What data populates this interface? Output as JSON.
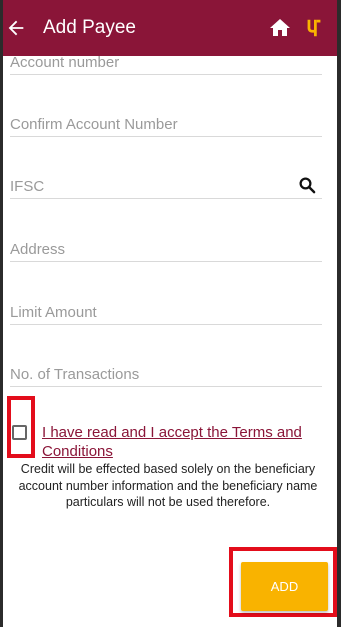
{
  "appbar": {
    "title": "Add Payee",
    "back_icon": "arrow-back-icon",
    "home_icon": "home-icon",
    "logo_icon": "bank-logo-icon",
    "background_color": "#8a1538"
  },
  "form": {
    "account_number": {
      "placeholder": "Account number"
    },
    "confirm_account_number": {
      "placeholder": "Confirm Account Number"
    },
    "ifsc": {
      "placeholder": "IFSC",
      "search_icon": "search-icon"
    },
    "address": {
      "placeholder": "Address"
    },
    "limit_amount": {
      "placeholder": "Limit Amount"
    },
    "no_of_transactions": {
      "placeholder": "No. of Transactions"
    }
  },
  "terms": {
    "checked": false,
    "label": "I have read and I accept the Terms and Conditions",
    "disclaimer": "Credit will be effected based solely on the beneficiary account number information and the beneficiary name particulars will not be used therefore."
  },
  "actions": {
    "add_label": "ADD",
    "add_color": "#f9b300"
  },
  "highlight_color": "#e30d1b"
}
